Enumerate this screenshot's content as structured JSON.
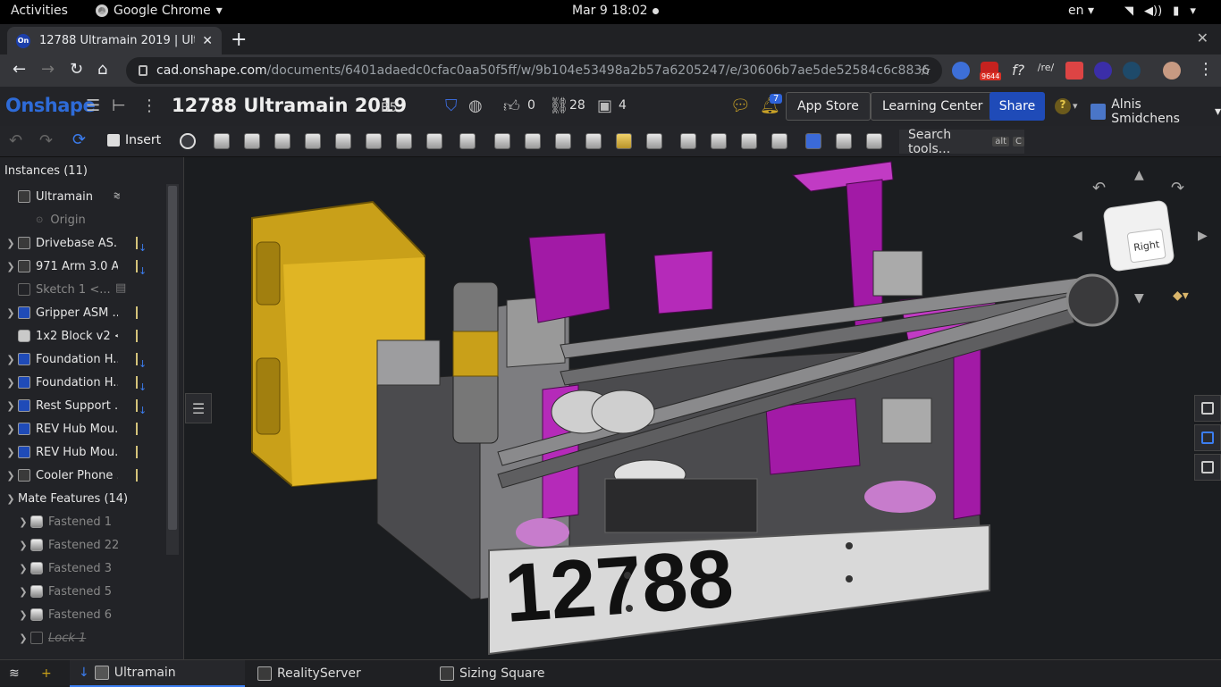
{
  "system": {
    "activities": "Activities",
    "app_name": "Google Chrome",
    "clock": "Mar 9  18:02",
    "language": "en"
  },
  "browser": {
    "tab_title": "12788 Ultramain 2019 | Ultram",
    "tab_favicon": "On",
    "url_host": "cad.onshape.com",
    "url_path": "/documents/6401adaedc0cfac0aa50f5ff/w/9b104e53498a2b57a6205247/e/30606b7ae5de52584c6c8836",
    "gmail_badge": "9644"
  },
  "header": {
    "logo": "Onshape",
    "doc_title": "12788 Ultramain 2019",
    "workspace": "B5",
    "likes": "0",
    "links": "28",
    "versions": "4",
    "notifications": "7",
    "app_store": "App Store",
    "learning_center": "Learning Center",
    "share": "Share",
    "user_name": "Alnis Smidchens"
  },
  "toolbar": {
    "insert": "Insert",
    "search_placeholder": "Search tools...",
    "search_kbd_1": "alt",
    "search_kbd_2": "C"
  },
  "panel": {
    "title": "Instances (11)",
    "items": [
      {
        "label": "Ultramain",
        "kind": "root"
      },
      {
        "label": "Origin",
        "kind": "origin"
      },
      {
        "label": "Drivebase AS...",
        "kind": "sub"
      },
      {
        "label": "971 Arm 3.0 A...",
        "kind": "sub"
      },
      {
        "label": "Sketch 1 <...",
        "kind": "sketch"
      },
      {
        "label": "Gripper ASM ...",
        "kind": "subb"
      },
      {
        "label": "1x2 Block v2 <...",
        "kind": "part"
      },
      {
        "label": "Foundation H...",
        "kind": "subb"
      },
      {
        "label": "Foundation H...",
        "kind": "subb"
      },
      {
        "label": "Rest Support ...",
        "kind": "subb"
      },
      {
        "label": "REV Hub Mou...",
        "kind": "subb"
      },
      {
        "label": "REV Hub Mou...",
        "kind": "subb"
      },
      {
        "label": "Cooler Phone ...",
        "kind": "sub"
      }
    ],
    "mates_title": "Mate Features (14)",
    "mates": [
      {
        "label": "Fastened 1"
      },
      {
        "label": "Fastened 22"
      },
      {
        "label": "Fastened 3"
      },
      {
        "label": "Fastened 5"
      },
      {
        "label": "Fastened 6"
      },
      {
        "label": "Lock 1"
      }
    ]
  },
  "viewcube": {
    "face_label": "Right"
  },
  "model": {
    "plate_number": "12788"
  },
  "tabs": [
    {
      "label": "Ultramain"
    },
    {
      "label": "RealityServer"
    },
    {
      "label": "Sizing Square"
    }
  ]
}
